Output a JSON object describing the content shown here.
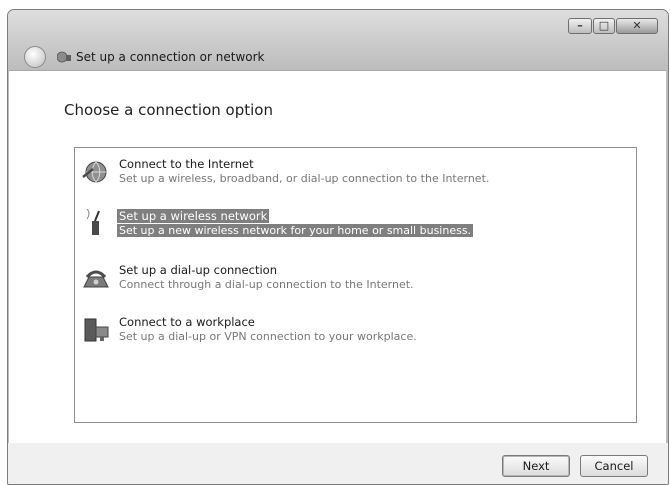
{
  "window": {
    "title": "Set up a connection or network",
    "controls": [
      "minimize-icon",
      "maximize-icon",
      "close-icon"
    ]
  },
  "main": {
    "heading": "Choose a connection option",
    "options": [
      {
        "icon": "internet-globe-icon",
        "title": "Connect to the Internet",
        "description": "Set up a wireless, broadband, or dial-up connection to the Internet.",
        "selected": false
      },
      {
        "icon": "wireless-network-icon",
        "title": "Set up a wireless network",
        "description": "Set up a new wireless network for your home or small business.",
        "selected": true
      },
      {
        "icon": "dial-up-phone-icon",
        "title": "Set up a dial-up connection",
        "description": "Connect through a dial-up connection to the Internet.",
        "selected": false
      },
      {
        "icon": "workplace-icon",
        "title": "Connect to a workplace",
        "description": "Set up a dial-up or VPN connection to your workplace.",
        "selected": false
      }
    ]
  },
  "footer": {
    "next_label": "Next",
    "cancel_label": "Cancel"
  }
}
